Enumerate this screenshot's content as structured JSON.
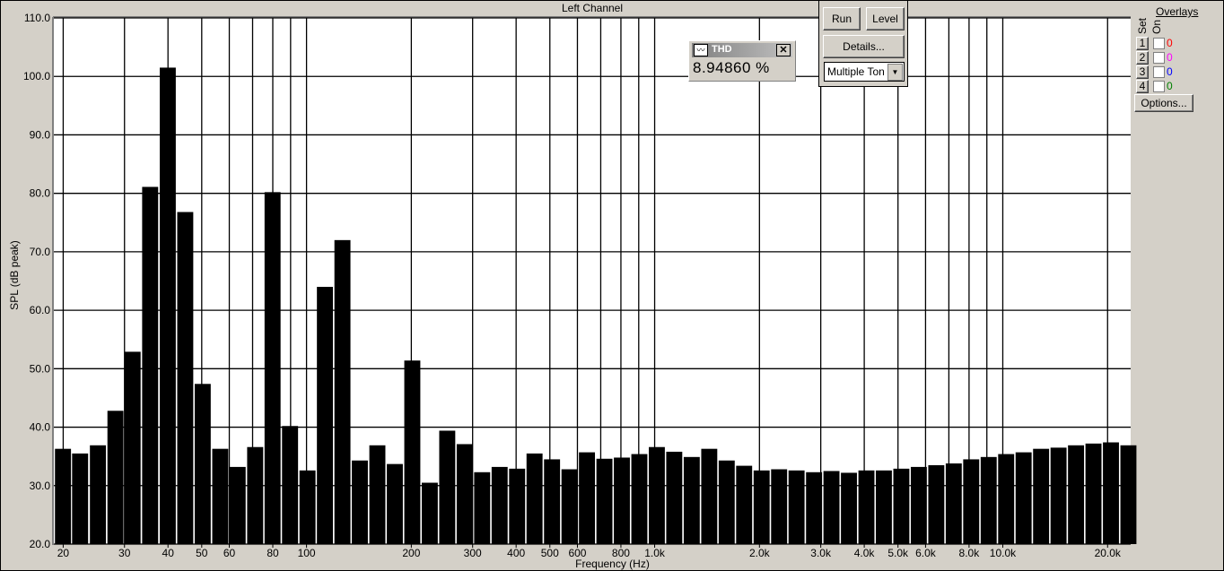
{
  "window": {
    "title": "Left Channel"
  },
  "thd": {
    "label": "THD",
    "value": "8.94860 %"
  },
  "controls": {
    "run": "Run",
    "level": "Level",
    "details": "Details...",
    "mode": "Multiple Ton"
  },
  "overlays": {
    "title": "Overlays",
    "set_label": "Set",
    "on_label": "On",
    "options": "Options...",
    "rows": [
      {
        "set": "1",
        "count": "0",
        "color": "#ff0000"
      },
      {
        "set": "2",
        "count": "0",
        "color": "#ff00ff"
      },
      {
        "set": "3",
        "count": "0",
        "color": "#0000ff"
      },
      {
        "set": "4",
        "count": "0",
        "color": "#008000"
      }
    ]
  },
  "chart_data": {
    "type": "bar",
    "xlabel": "Frequency (Hz)",
    "ylabel": "SPL (dB peak)",
    "title": "Left Channel",
    "x_scale": "log",
    "xlim": [
      18.8,
      23300
    ],
    "ylim": [
      20,
      110
    ],
    "grid": true,
    "bar_color": "#000000",
    "yticks": [
      "20.0",
      "30.0",
      "40.0",
      "50.0",
      "60.0",
      "70.0",
      "80.0",
      "90.0",
      "100.0",
      "110.0"
    ],
    "xticks": [
      {
        "v": 20,
        "l": "20"
      },
      {
        "v": 30,
        "l": "30"
      },
      {
        "v": 40,
        "l": "40"
      },
      {
        "v": 50,
        "l": "50"
      },
      {
        "v": 60,
        "l": "60"
      },
      {
        "v": 80,
        "l": "80"
      },
      {
        "v": 100,
        "l": "100"
      },
      {
        "v": 200,
        "l": "200"
      },
      {
        "v": 300,
        "l": "300"
      },
      {
        "v": 400,
        "l": "400"
      },
      {
        "v": 500,
        "l": "500"
      },
      {
        "v": 600,
        "l": "600"
      },
      {
        "v": 800,
        "l": "800"
      },
      {
        "v": 1000,
        "l": "1.0k"
      },
      {
        "v": 2000,
        "l": "2.0k"
      },
      {
        "v": 3000,
        "l": "3.0k"
      },
      {
        "v": 4000,
        "l": "4.0k"
      },
      {
        "v": 5000,
        "l": "5.0k"
      },
      {
        "v": 6000,
        "l": "6.0k"
      },
      {
        "v": 8000,
        "l": "8.0k"
      },
      {
        "v": 10000,
        "l": "10.0k"
      },
      {
        "v": 20000,
        "l": "20.0k"
      }
    ],
    "gridx": [
      20,
      30,
      40,
      50,
      60,
      70,
      80,
      90,
      100,
      200,
      300,
      400,
      500,
      600,
      700,
      800,
      900,
      1000,
      2000,
      3000,
      4000,
      5000,
      6000,
      7000,
      8000,
      9000,
      10000,
      20000
    ],
    "x": [
      20,
      22.4,
      25.2,
      28.3,
      31.7,
      35.6,
      40,
      44.9,
      50.4,
      56.6,
      63.5,
      71.3,
      80,
      89.8,
      100.8,
      113.1,
      127,
      142.5,
      160,
      179.6,
      201.6,
      226.3,
      254,
      285.1,
      320,
      359.2,
      403.2,
      452.5,
      508,
      570.2,
      640,
      718.4,
      806.3,
      905.1,
      1016,
      1140,
      1280,
      1437,
      1613,
      1810,
      2032,
      2281,
      2560,
      2874,
      3225,
      3620,
      4064,
      4561,
      5120,
      5747,
      6451,
      7241,
      8127,
      9123,
      10240,
      11494,
      12902,
      14482,
      16255,
      18246,
      20480,
      22988
    ],
    "values": [
      36.3,
      35.5,
      36.9,
      42.8,
      52.9,
      81.1,
      101.5,
      76.8,
      47.4,
      36.3,
      33.2,
      36.6,
      80.2,
      40.2,
      32.6,
      64,
      72,
      34.3,
      36.9,
      33.7,
      51.4,
      30.5,
      39.4,
      37.1,
      32.3,
      33.2,
      32.9,
      35.5,
      34.5,
      32.8,
      35.7,
      34.6,
      34.8,
      35.4,
      36.6,
      35.8,
      34.9,
      36.3,
      34.3,
      33.4,
      32.6,
      32.8,
      32.6,
      32.3,
      32.5,
      32.2,
      32.6,
      32.6,
      32.9,
      33.2,
      33.5,
      33.8,
      34.5,
      34.9,
      35.4,
      35.7,
      36.3,
      36.5,
      36.9,
      37.2,
      37.4,
      36.9
    ]
  }
}
